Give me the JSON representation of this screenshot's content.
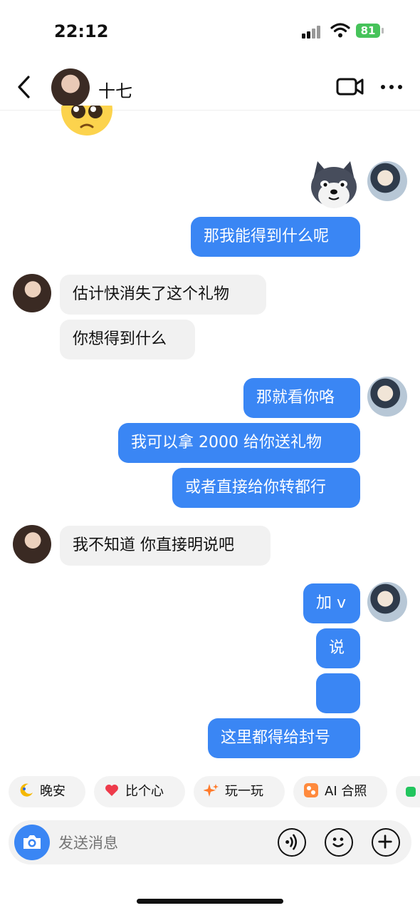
{
  "status_bar": {
    "time": "22:12",
    "battery": "81"
  },
  "header": {
    "contact_name": "十七"
  },
  "messages": {
    "m1": "那我能得到什么呢",
    "m2": "估计快消失了这个礼物",
    "m3": "你想得到什么",
    "m4": "那就看你咯",
    "m5": "我可以拿 2000 给你送礼物",
    "m6": "或者直接给你转都行",
    "m7": "我不知道 你直接明说吧",
    "m8": "加 v",
    "m9": "说",
    "m10": "",
    "m11": "这里都得给封号"
  },
  "quick_replies": [
    "晚安",
    "比个心",
    "玩一玩",
    "AI 合照"
  ],
  "input": {
    "placeholder": "发送消息"
  },
  "colors": {
    "accent": "#3a86f4",
    "incoming_bubble": "#f1f1f1",
    "battery": "#46c35a"
  },
  "icons": [
    "back-arrow-icon",
    "video-call-icon",
    "more-icon",
    "camera-icon",
    "voice-icon",
    "emoji-icon",
    "plus-icon"
  ]
}
